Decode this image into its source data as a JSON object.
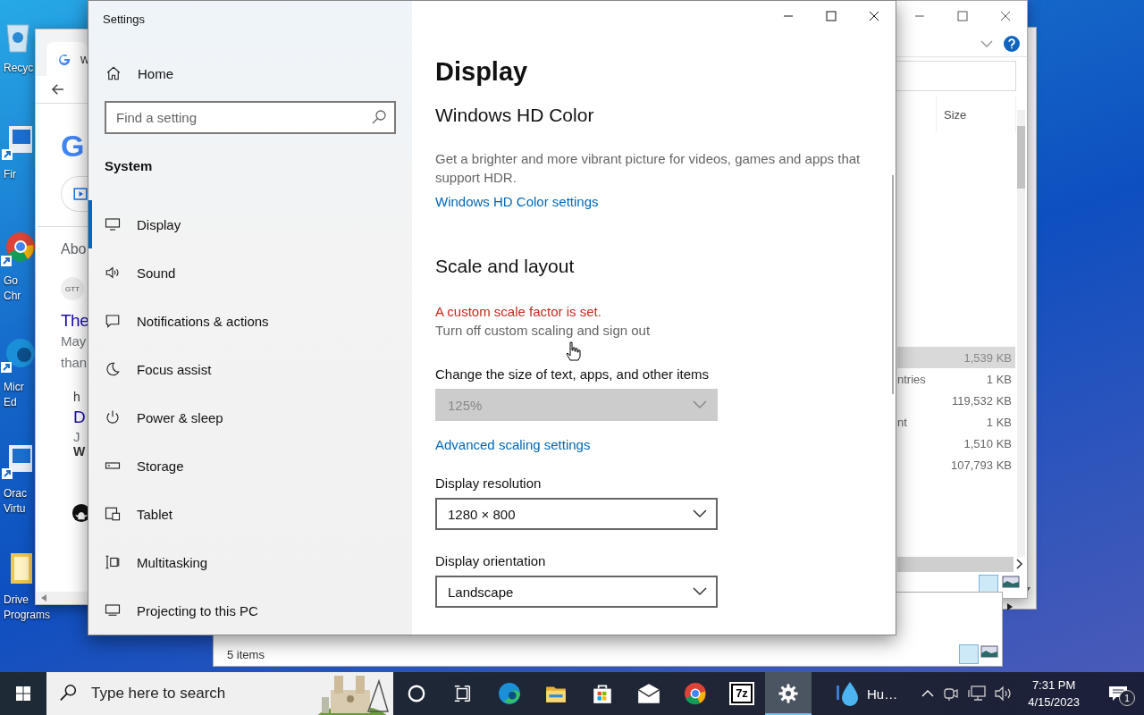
{
  "desktop_icons": [
    {
      "kind": "recycle",
      "label": "Recyc"
    },
    {
      "kind": "app",
      "label": "Fir"
    },
    {
      "kind": "chrome",
      "label": "Go\nChr"
    },
    {
      "kind": "edge",
      "label": "Micr\nEd"
    },
    {
      "kind": "app",
      "label": "Orac\nVirtu"
    },
    {
      "kind": "folder",
      "label": "Drive\nPrograms"
    }
  ],
  "browser": {
    "tab_title": "w",
    "logo": "G",
    "about": "Abo",
    "avatar": "GTT",
    "result_title": "The",
    "snippet": [
      "May",
      "than"
    ],
    "second_result": {
      "url": "h",
      "title": "D",
      "date": "J",
      "bold": "W"
    }
  },
  "settings": {
    "title": "Settings",
    "home": "Home",
    "search": {
      "placeholder": "Find a setting"
    },
    "section": "System",
    "nav": [
      {
        "kind": "monitor",
        "label": "Display",
        "selected": true
      },
      {
        "kind": "speaker",
        "label": "Sound",
        "selected": false
      },
      {
        "kind": "message",
        "label": "Notifications & actions",
        "selected": false
      },
      {
        "kind": "moon",
        "label": "Focus assist",
        "selected": false
      },
      {
        "kind": "power",
        "label": "Power & sleep",
        "selected": false
      },
      {
        "kind": "drive",
        "label": "Storage",
        "selected": false
      },
      {
        "kind": "tablet",
        "label": "Tablet",
        "selected": false
      },
      {
        "kind": "multitask",
        "label": "Multitasking",
        "selected": false
      },
      {
        "kind": "project",
        "label": "Projecting to this PC",
        "selected": false
      }
    ],
    "page_title": "Display",
    "blocks": [
      {
        "kind": "heading",
        "text": "Windows HD Color"
      },
      {
        "kind": "text",
        "text": "Get a brighter and more vibrant picture for videos, games and apps that support HDR."
      },
      {
        "kind": "link",
        "text": "Windows HD Color settings"
      },
      {
        "kind": "heading",
        "text": "Scale and layout"
      },
      {
        "kind": "warning",
        "text": "A custom scale factor is set."
      },
      {
        "kind": "action",
        "text": "Turn off custom scaling and sign out"
      },
      {
        "kind": "label",
        "text": "Change the size of text, apps, and other items"
      },
      {
        "kind": "dropdown",
        "value": "125%",
        "disabled": true
      },
      {
        "kind": "link",
        "text": "Advanced scaling settings"
      },
      {
        "kind": "label",
        "text": "Display resolution"
      },
      {
        "kind": "dropdown",
        "value": "1280 × 800",
        "disabled": false
      },
      {
        "kind": "label",
        "text": "Display orientation"
      },
      {
        "kind": "dropdown",
        "value": "Landscape",
        "disabled": false
      }
    ]
  },
  "explorer": {
    "column": "Size",
    "rows": [
      {
        "size": "1,539 KB",
        "selected": true
      },
      {
        "name": "ntries",
        "size": "1 KB",
        "selected": false
      },
      {
        "size": "119,532 KB",
        "selected": false
      },
      {
        "name": "nt",
        "size": "1 KB",
        "selected": false
      },
      {
        "size": "1,510 KB",
        "selected": false
      },
      {
        "size": "107,793 KB",
        "selected": false
      }
    ]
  },
  "explorer2": {
    "status": "5 items"
  },
  "taskbar": {
    "search": {
      "placeholder": "Type here to search"
    },
    "apps": [
      {
        "kind": "cortana",
        "selected": false
      },
      {
        "kind": "taskview",
        "selected": false
      },
      {
        "kind": "edge",
        "selected": false
      },
      {
        "kind": "explorer",
        "selected": false
      },
      {
        "kind": "store",
        "selected": false
      },
      {
        "kind": "mail",
        "selected": false
      },
      {
        "kind": "chrome",
        "selected": false
      },
      {
        "kind": "sevenzip",
        "label": "7z",
        "selected": false
      },
      {
        "kind": "settings",
        "selected": true
      }
    ],
    "weather": "Hu…",
    "time": "7:31 PM",
    "date": "4/15/2023",
    "notifications": "1"
  }
}
